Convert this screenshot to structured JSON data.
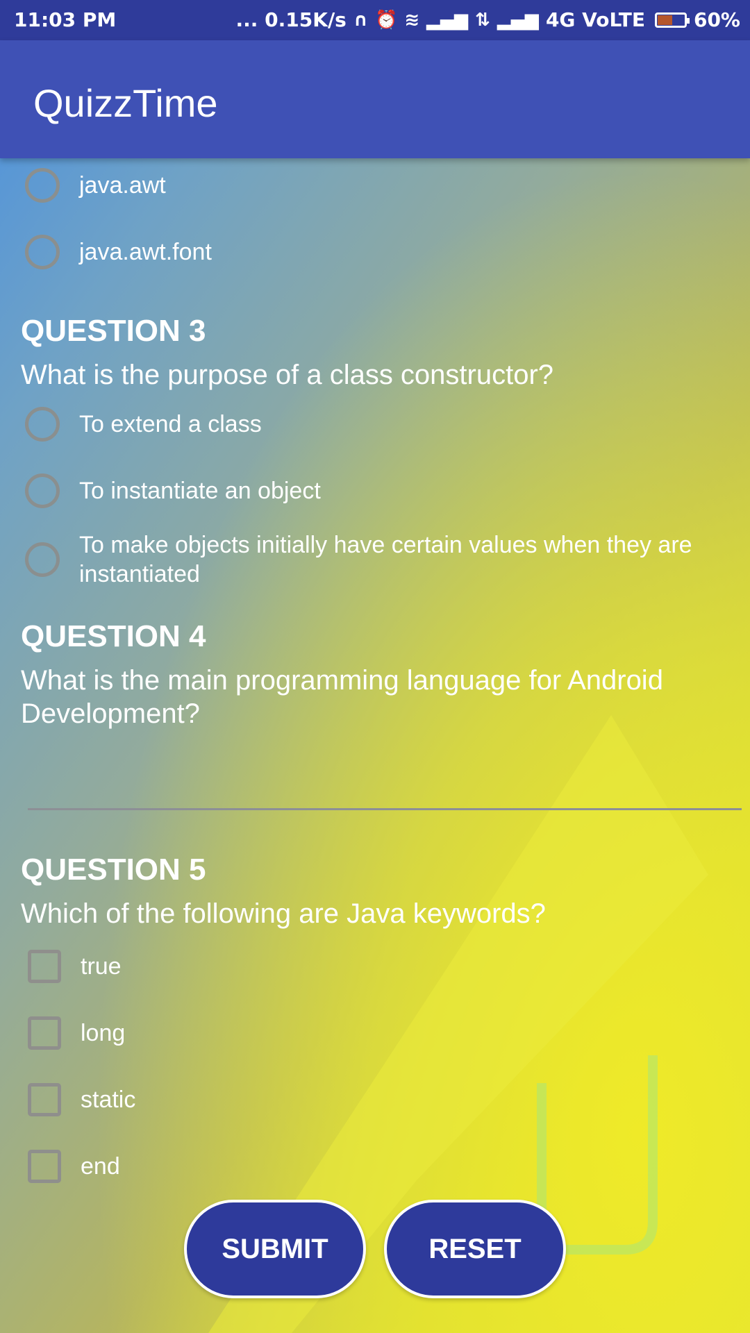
{
  "status_bar": {
    "time": "11:03 PM",
    "speed": "... 0.15K/s",
    "network": "4G VoLTE",
    "battery": "60%",
    "battery_level": 0.6
  },
  "app_bar": {
    "title": "QuizzTime"
  },
  "question2_options": [
    "java.awt",
    "java.awt.font"
  ],
  "question3": {
    "heading": "QUESTION 3",
    "text": "What is the purpose of a class constructor?",
    "options": [
      "To extend a class",
      "To instantiate an object",
      "To make objects initially have certain values when they are instantiated"
    ]
  },
  "question4": {
    "heading": "QUESTION 4",
    "text": "What is the main programming language for Android Development?",
    "answer_value": ""
  },
  "question5": {
    "heading": "QUESTION 5",
    "text": "Which of the following are Java keywords?",
    "options": [
      "true",
      "long",
      "static",
      "end"
    ]
  },
  "buttons": {
    "submit": "SUBMIT",
    "reset": "RESET"
  },
  "colors": {
    "status_bar": "#2f3b9a",
    "app_bar": "#3f51b5",
    "button": "#2e3a9b"
  }
}
